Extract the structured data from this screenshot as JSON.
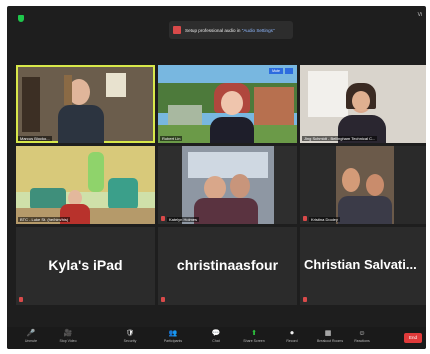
{
  "top": {
    "view_label": "Vi",
    "notice_text": "Setup professional audio in ",
    "notice_link": "\"Audio Settings\""
  },
  "tiles": [
    {
      "name": "Marcus Blocko..."
    },
    {
      "name": "Robert Lin",
      "badge": "Mute"
    },
    {
      "name": "Jing Schmidt - Bellingham Technical C..."
    },
    {
      "name": "BTC - Luke St. (he/him/his)"
    },
    {
      "name": "Katelyn Holmes"
    },
    {
      "name": "Kristina Dooley"
    },
    {
      "name": "Kyla's iPad"
    },
    {
      "name": "christinaasfour"
    },
    {
      "name": "Christian  Salvati..."
    }
  ],
  "toolbar": {
    "items": [
      {
        "icon": "🎤",
        "label": "Unmute"
      },
      {
        "icon": "🎥",
        "label": "Stop Video"
      },
      {
        "icon": "🛡",
        "label": "Security"
      },
      {
        "icon": "👥",
        "label": "Participants"
      },
      {
        "icon": "💬",
        "label": "Chat"
      },
      {
        "icon": "⬆",
        "label": "Share Screen"
      },
      {
        "icon": "⏺",
        "label": "Record"
      },
      {
        "icon": "▦",
        "label": "Breakout Rooms"
      },
      {
        "icon": "☺",
        "label": "Reactions"
      }
    ],
    "end_label": "End"
  },
  "colors": {
    "active_speaker": "#d8e84a",
    "end": "#e03a3a",
    "share": "#2ecc40"
  }
}
